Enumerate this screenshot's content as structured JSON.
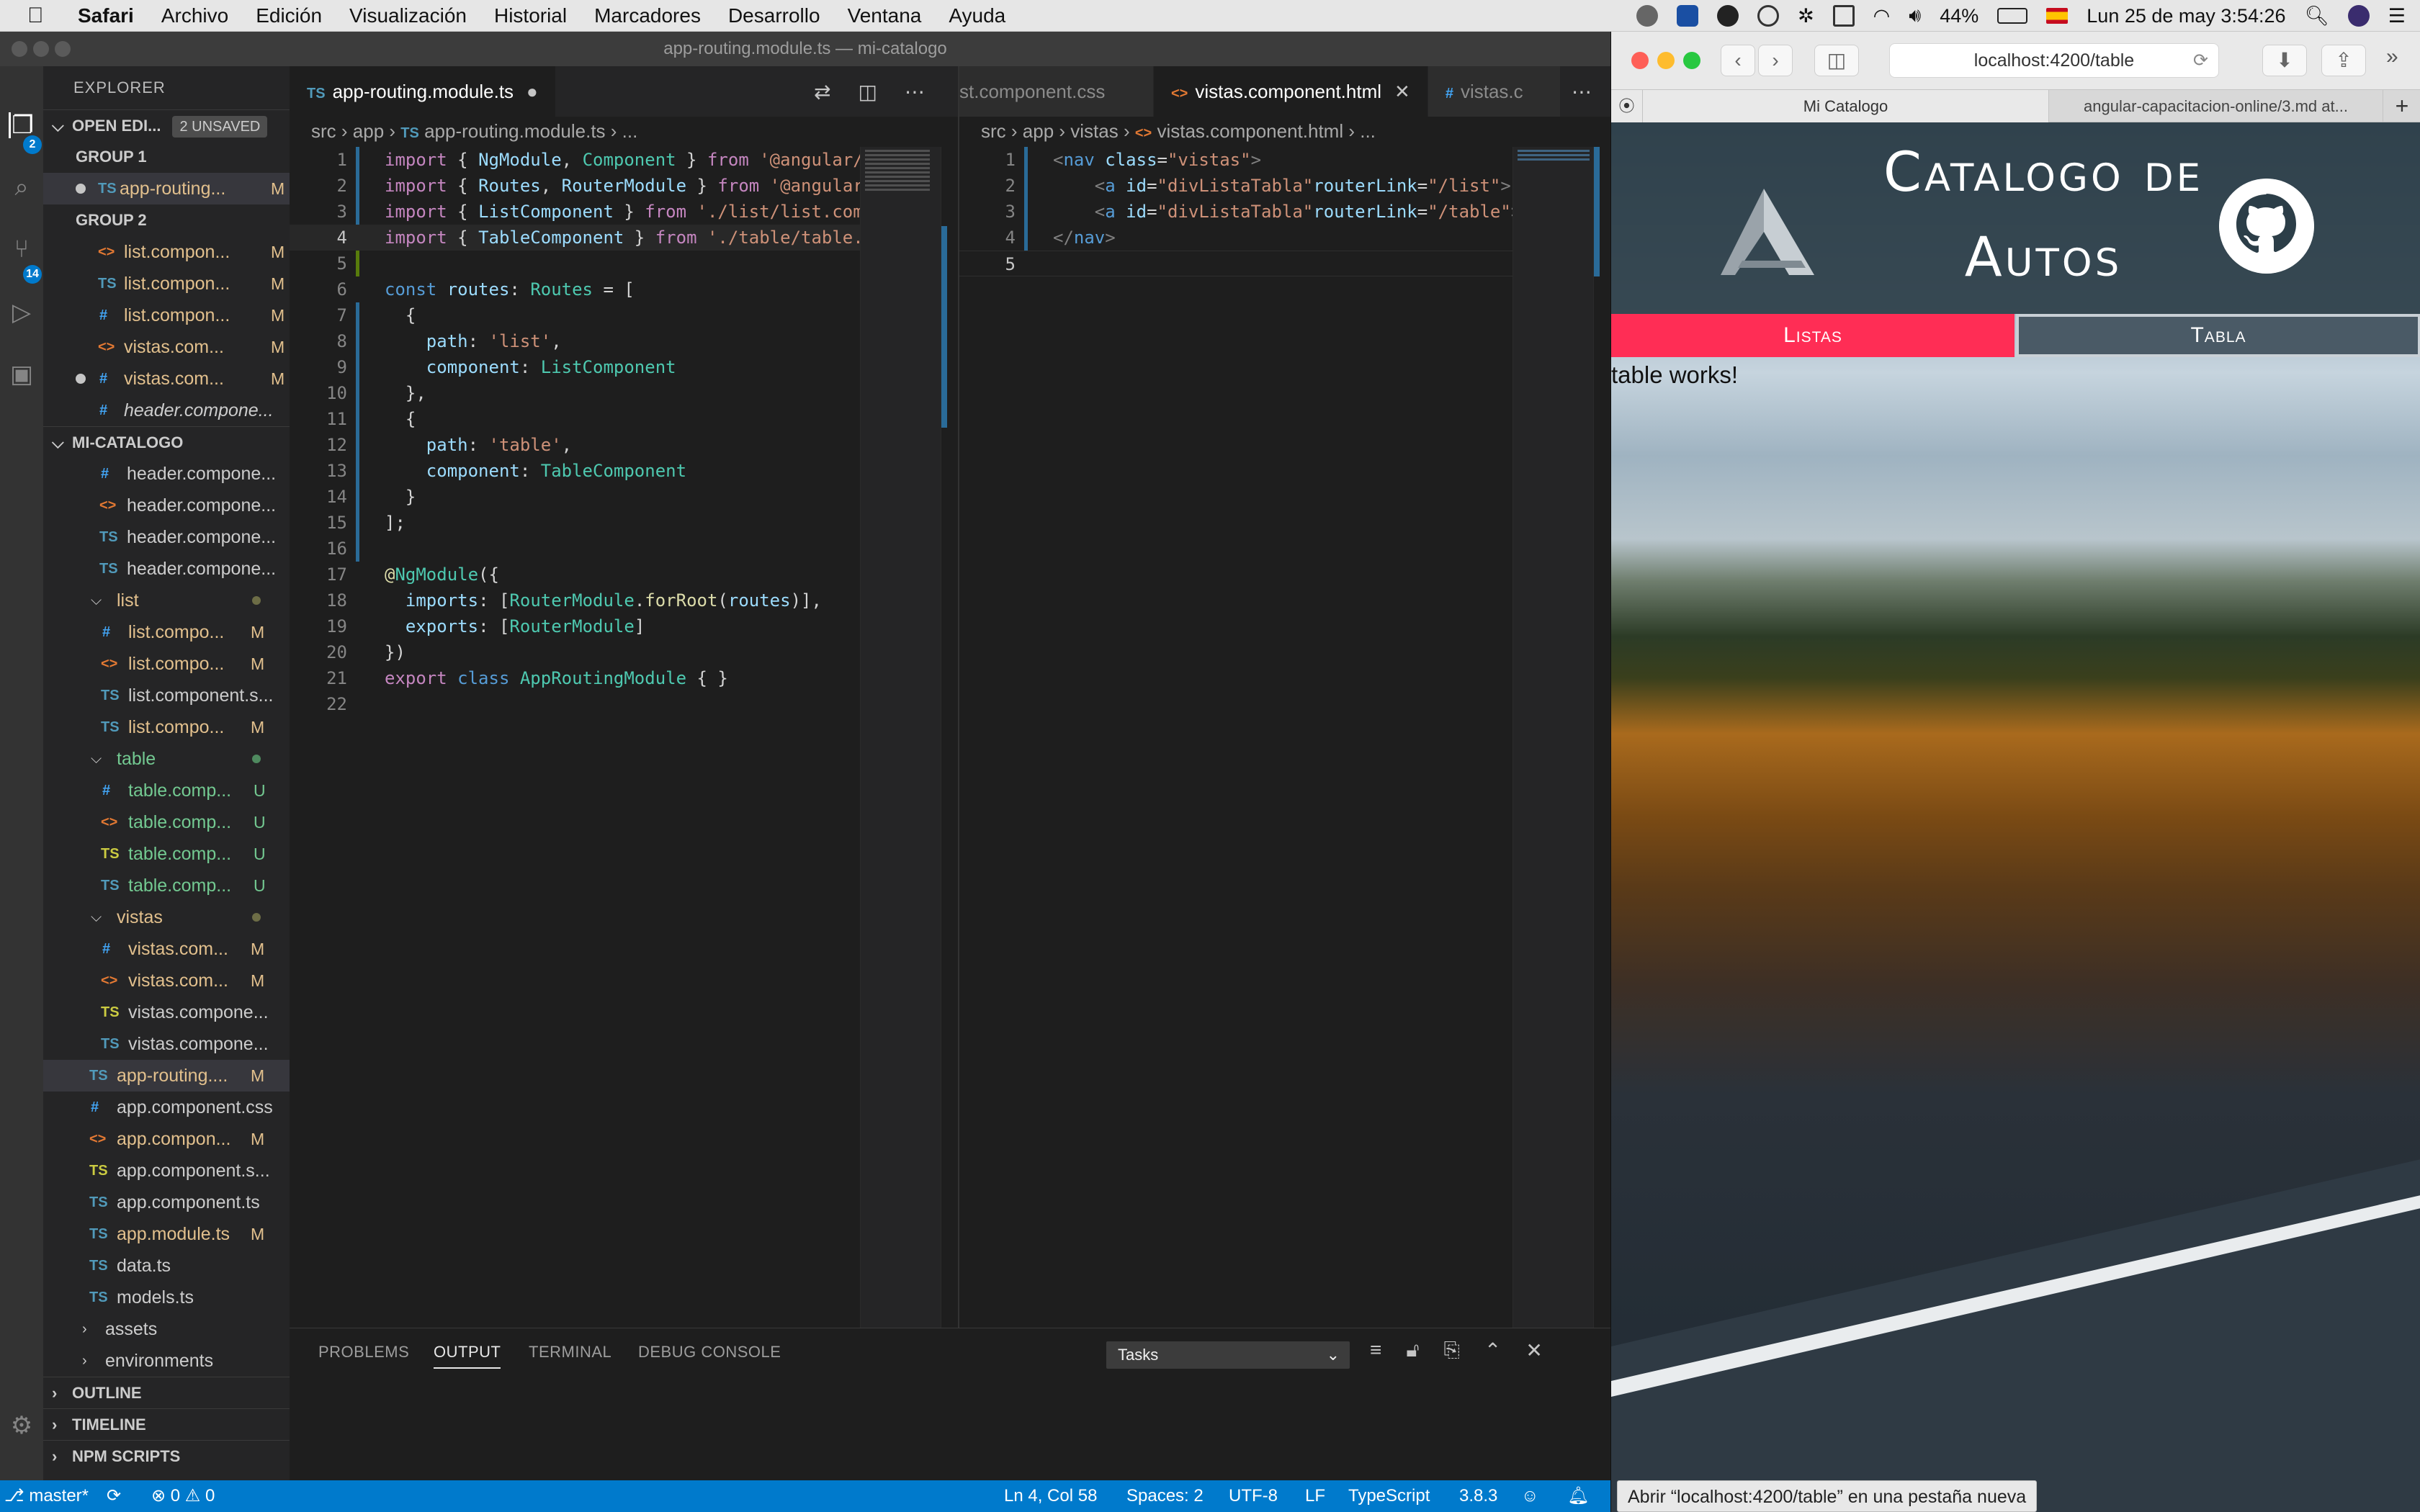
{
  "menubar": {
    "app": "Safari",
    "items": [
      "Archivo",
      "Edición",
      "Visualización",
      "Historial",
      "Marcadores",
      "Desarrollo",
      "Ventana",
      "Ayuda"
    ],
    "battery": "44%",
    "clock": "Lun 25 de may  3:54:26"
  },
  "vscode": {
    "window_title": "app-routing.module.ts — mi-catalogo",
    "activity": {
      "explorer_badge": "2",
      "scm_badge": "14"
    },
    "explorer": {
      "title": "EXPLORER",
      "open_editors": {
        "label": "OPEN EDI...",
        "badge": "2 UNSAVED"
      },
      "group1": {
        "label": "GROUP 1",
        "files": [
          {
            "icon": "TS",
            "name": "app-routing...",
            "status": "M"
          }
        ]
      },
      "group2": {
        "label": "GROUP 2",
        "files": [
          {
            "icon": "<>",
            "name": "list.compon...",
            "status": "M"
          },
          {
            "icon": "TS",
            "name": "list.compon...",
            "status": "M"
          },
          {
            "icon": "#",
            "name": "list.compon...",
            "status": "M"
          },
          {
            "icon": "<>",
            "name": "vistas.com...",
            "status": "M"
          },
          {
            "icon": "#",
            "name": "vistas.com...",
            "status": "M"
          },
          {
            "icon": "#",
            "name": "header.compone...",
            "status": ""
          }
        ]
      },
      "project": {
        "label": "MI-CATALOGO",
        "header_files": [
          {
            "icon": "#",
            "name": "header.compone..."
          },
          {
            "icon": "<>",
            "name": "header.compone..."
          },
          {
            "icon": "TS",
            "name": "header.compone..."
          },
          {
            "icon": "TS",
            "name": "header.compone..."
          }
        ],
        "list_folder": "list",
        "list_files": [
          {
            "icon": "#",
            "name": "list.compo...",
            "status": "M"
          },
          {
            "icon": "<>",
            "name": "list.compo...",
            "status": "M"
          },
          {
            "icon": "TS",
            "name": "list.component.s...",
            "status": ""
          },
          {
            "icon": "TS",
            "name": "list.compo...",
            "status": "M"
          }
        ],
        "table_folder": "table",
        "table_files": [
          {
            "icon": "#",
            "name": "table.comp...",
            "status": "U"
          },
          {
            "icon": "<>",
            "name": "table.comp...",
            "status": "U"
          },
          {
            "icon": "TS",
            "name": "table.comp...",
            "status": "U"
          },
          {
            "icon": "TS",
            "name": "table.comp...",
            "status": "U"
          }
        ],
        "vistas_folder": "vistas",
        "vistas_files": [
          {
            "icon": "#",
            "name": "vistas.com...",
            "status": "M"
          },
          {
            "icon": "<>",
            "name": "vistas.com...",
            "status": "M"
          },
          {
            "icon": "TS",
            "name": "vistas.compone...",
            "status": ""
          },
          {
            "icon": "TS",
            "name": "vistas.compone...",
            "status": ""
          }
        ],
        "app_files": [
          {
            "icon": "TS",
            "name": "app-routing....",
            "status": "M"
          },
          {
            "icon": "#",
            "name": "app.component.css",
            "status": ""
          },
          {
            "icon": "<>",
            "name": "app.compon...",
            "status": "M"
          },
          {
            "icon": "TS",
            "name": "app.component.s...",
            "status": ""
          },
          {
            "icon": "TS",
            "name": "app.component.ts",
            "status": ""
          },
          {
            "icon": "TS",
            "name": "app.module.ts",
            "status": "M"
          },
          {
            "icon": "TS",
            "name": "data.ts",
            "status": ""
          },
          {
            "icon": "TS",
            "name": "models.ts",
            "status": ""
          }
        ],
        "folders": [
          "assets",
          "environments"
        ]
      },
      "outline": "OUTLINE",
      "timeline": "TIMELINE",
      "npm": "NPM SCRIPTS"
    },
    "editor1": {
      "tab": {
        "icon": "TS",
        "label": "app-routing.module.ts"
      },
      "breadcrumb": [
        "src",
        "app",
        "app-routing.module.ts",
        "..."
      ],
      "line_numbers": [
        "1",
        "2",
        "3",
        "4",
        "5",
        "6",
        "7",
        "8",
        "9",
        "10",
        "11",
        "12",
        "13",
        "14",
        "15",
        "16",
        "17",
        "18",
        "19",
        "20",
        "21",
        "22"
      ]
    },
    "editor2": {
      "tabs": [
        {
          "icon": "",
          "label": "st.component.css"
        },
        {
          "icon": "<>",
          "label": "vistas.component.html"
        },
        {
          "icon": "#",
          "label": "vistas.c"
        }
      ],
      "breadcrumb": [
        "src",
        "app",
        "vistas",
        "vistas.component.html",
        "..."
      ],
      "line_numbers": [
        "1",
        "2",
        "3",
        "4",
        "5"
      ]
    },
    "panel": {
      "tabs": [
        "PROBLEMS",
        "OUTPUT",
        "TERMINAL",
        "DEBUG CONSOLE"
      ],
      "active_tab": "OUTPUT",
      "select": "Tasks"
    },
    "statusbar": {
      "branch": "master*",
      "errors": "0",
      "warnings": "0",
      "position": "Ln 4, Col 58",
      "spaces": "Spaces: 2",
      "encoding": "UTF-8",
      "eol": "LF",
      "language": "TypeScript",
      "version": "3.8.3"
    }
  },
  "safari": {
    "url": "localhost:4200/table",
    "tabs": [
      "Mi Catalogo",
      "angular-capacitacion-online/3.md at..."
    ],
    "status_tip": "Abrir “localhost:4200/table” en una pestaña nueva",
    "page": {
      "title_line1": "Catalogo de",
      "title_line2": "Autos",
      "nav": [
        "Listas",
        "Tabla"
      ],
      "content": "table works!"
    }
  },
  "colors": {
    "accent_blue": "#007acc",
    "nav_active": "#ff2d55",
    "header_bg": "#2c3e48"
  }
}
